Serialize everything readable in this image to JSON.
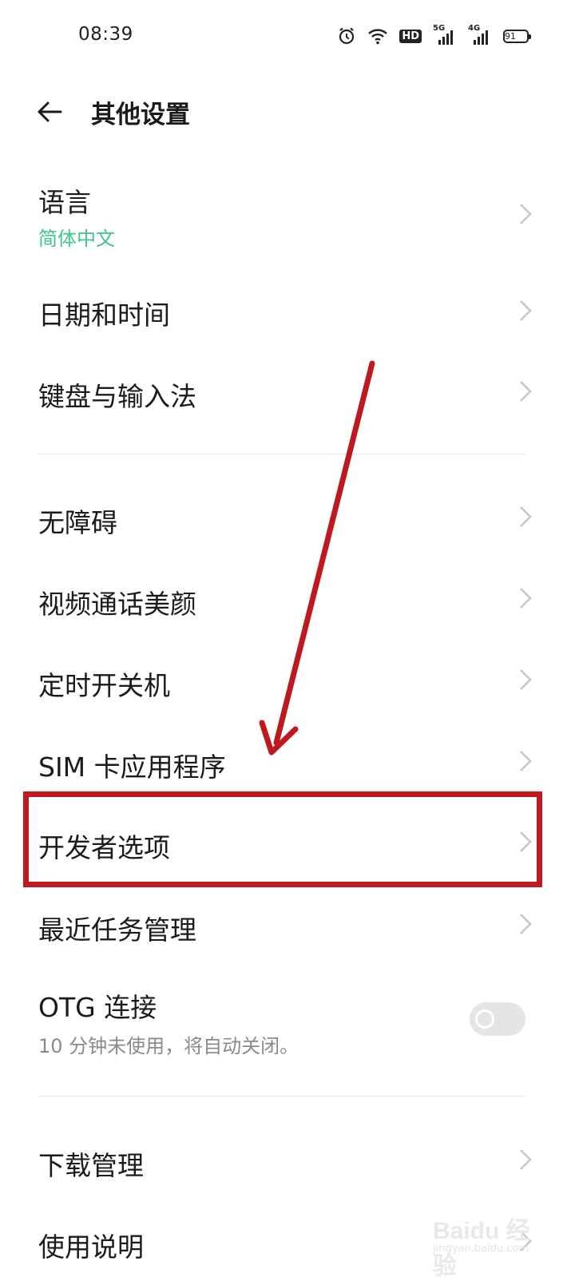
{
  "status_bar": {
    "time": "08:39",
    "hd_label": "HD",
    "net1_label": "5G",
    "net2_label": "4G",
    "battery": "91"
  },
  "header": {
    "title": "其他设置"
  },
  "items": [
    {
      "label": "语言",
      "sub": "简体中文",
      "sub_color": "#3dc58e"
    },
    {
      "label": "日期和时间"
    },
    {
      "label": "键盘与输入法"
    },
    {
      "label": "无障碍"
    },
    {
      "label": "视频通话美颜"
    },
    {
      "label": "定时开关机"
    },
    {
      "label": "SIM 卡应用程序"
    },
    {
      "label": "开发者选项"
    },
    {
      "label": "最近任务管理"
    },
    {
      "label": "OTG 连接",
      "sub": "10 分钟未使用，将自动关闭。",
      "toggle_on": false
    },
    {
      "label": "下载管理"
    },
    {
      "label": "使用说明"
    }
  ],
  "annotation": {
    "color": "#c0181f"
  },
  "watermark": {
    "text": "Baidu 经验",
    "url": "jingyan.baidu.com"
  }
}
